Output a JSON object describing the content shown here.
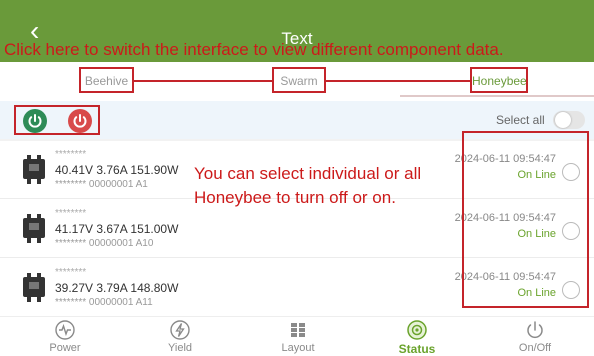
{
  "header": {
    "title": "Text",
    "back_icon": "chevron-left-icon"
  },
  "annotations": {
    "top": "Click here to switch the interface to view different component data.",
    "middle": "You can select individual or all Honeybee to turn off or on."
  },
  "tabs": [
    {
      "label": "Beehive",
      "active": false
    },
    {
      "label": "Swarm",
      "active": false
    },
    {
      "label": "Honeybee",
      "active": true
    }
  ],
  "toolbar": {
    "power_on_icon": "power-on-icon",
    "power_off_icon": "power-off-icon",
    "select_all_label": "Select all",
    "select_all_on": false
  },
  "devices": [
    {
      "serial": "********",
      "metrics": "40.41V 3.76A 151.90W",
      "ident": "******** 00000001 A1",
      "timestamp": "2024-06-11 09:54:47",
      "status": "On Line"
    },
    {
      "serial": "********",
      "metrics": "41.17V 3.67A 151.00W",
      "ident": "******** 00000001 A10",
      "timestamp": "2024-06-11 09:54:47",
      "status": "On Line"
    },
    {
      "serial": "********",
      "metrics": "39.27V 3.79A 148.80W",
      "ident": "******** 00000001 A11",
      "timestamp": "2024-06-11 09:54:47",
      "status": "On Line"
    }
  ],
  "nav": [
    {
      "label": "Power",
      "icon": "power-wave-icon",
      "active": false
    },
    {
      "label": "Yield",
      "icon": "lightning-icon",
      "active": false
    },
    {
      "label": "Layout",
      "icon": "grid-icon",
      "active": false
    },
    {
      "label": "Status",
      "icon": "status-icon",
      "active": true
    },
    {
      "label": "On/Off",
      "icon": "power-icon",
      "active": false
    }
  ],
  "colors": {
    "header": "#6a9a3a",
    "accent": "#6aa32c",
    "annotation": "#cc1a1a",
    "online": "#6aa32c"
  }
}
